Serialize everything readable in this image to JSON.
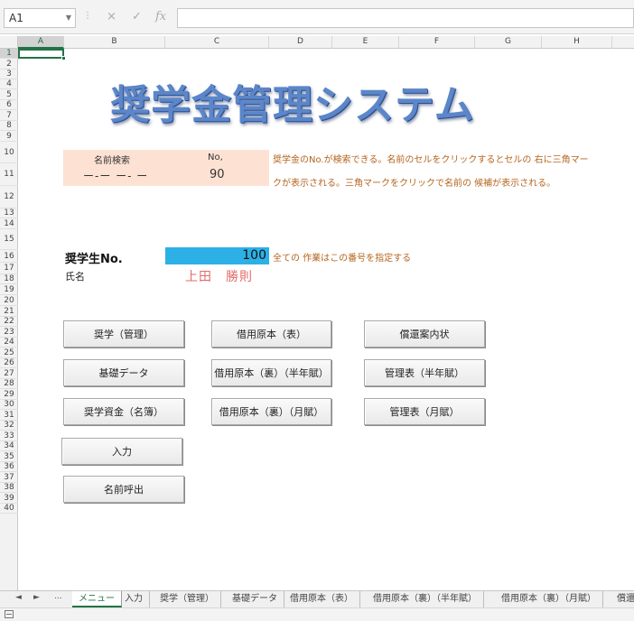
{
  "formula_bar": {
    "name_box": "A1",
    "cancel_icon": "×",
    "enter_icon": "✓",
    "fx_icon": "fx",
    "formula": ""
  },
  "columns": [
    "A",
    "B",
    "C",
    "D",
    "E",
    "F",
    "G",
    "H"
  ],
  "rows": [
    "1",
    "2",
    "3",
    "4",
    "5",
    "6",
    "7",
    "8",
    "9",
    "10",
    "11",
    "12",
    "13",
    "14",
    "15",
    "16",
    "17",
    "18",
    "19",
    "20",
    "21",
    "22",
    "23",
    "24",
    "25",
    "26",
    "27",
    "28",
    "29",
    "30",
    "31",
    "32",
    "33",
    "34",
    "35",
    "36",
    "37",
    "38",
    "39",
    "40"
  ],
  "sheet": {
    "title": "奨学金管理システム",
    "search": {
      "label_name": "名前検索",
      "label_no": "No,",
      "name_value": "ー‐ー  ー‐  ー",
      "no_value": "90"
    },
    "hint_line1": "奨学金のNo.が検索できる。名前のセルをクリックするとセルの 右に三角マー",
    "hint_line2": "クが表示される。三角マークをクリックで名前の 候補が表示される。",
    "student_no_label": "奨学生No.",
    "student_no_value": "100",
    "student_no_hint": "全ての 作業はこの番号を指定する",
    "name_label": "氏名",
    "name_value": "上田　勝則",
    "buttons": {
      "b1": "奨学（管理）",
      "b2": "基礎データ",
      "b3": "奨学資金（名簿）",
      "b4": "入力",
      "b5": "名前呼出",
      "c1": "借用原本（表）",
      "c2": "借用原本（裏）（半年賦）",
      "c3": "借用原本（裏）（月賦）",
      "d1": "償還案内状",
      "d2": "管理表（半年賦）",
      "d3": "管理表（月賦）"
    }
  },
  "tab_nav": {
    "prev": "◄",
    "next": "►",
    "more": "..."
  },
  "tabs": [
    "メニュー",
    "入力",
    "奨学（管理）",
    "基礎データ",
    "借用原本（表）",
    "借用原本（裏）（半年賦）",
    "借用原本（裏）（月賦）",
    "償還"
  ]
}
